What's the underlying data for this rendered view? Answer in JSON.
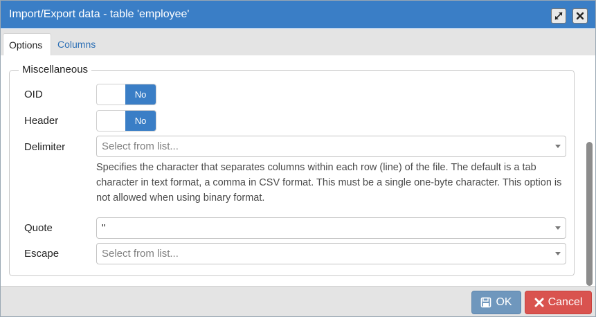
{
  "window": {
    "title": "Import/Export data - table 'employee'",
    "maximize_icon": "expand-arrows-icon",
    "close_icon": "close-icon"
  },
  "tabs": [
    {
      "label": "Options",
      "active": true
    },
    {
      "label": "Columns",
      "active": false
    }
  ],
  "miscellaneous": {
    "legend": "Miscellaneous",
    "oid": {
      "label": "OID",
      "value": "No"
    },
    "header": {
      "label": "Header",
      "value": "No"
    },
    "delimiter": {
      "label": "Delimiter",
      "placeholder": "Select from list...",
      "help": "Specifies the character that separates columns within each row (line) of the file. The default is a tab character in text format, a comma in CSV format. This must be a single one-byte character. This option is not allowed when using binary format."
    },
    "quote": {
      "label": "Quote",
      "value": "\""
    },
    "escape": {
      "label": "Escape",
      "placeholder": "Select from list..."
    }
  },
  "footer": {
    "ok_label": "OK",
    "ok_icon": "save-icon",
    "cancel_label": "Cancel",
    "cancel_icon": "x-icon"
  },
  "colors": {
    "accent": "#3a7ec6",
    "ok_button": "#6f97bd",
    "cancel_button": "#d9534f",
    "link": "#2c6fb5"
  }
}
